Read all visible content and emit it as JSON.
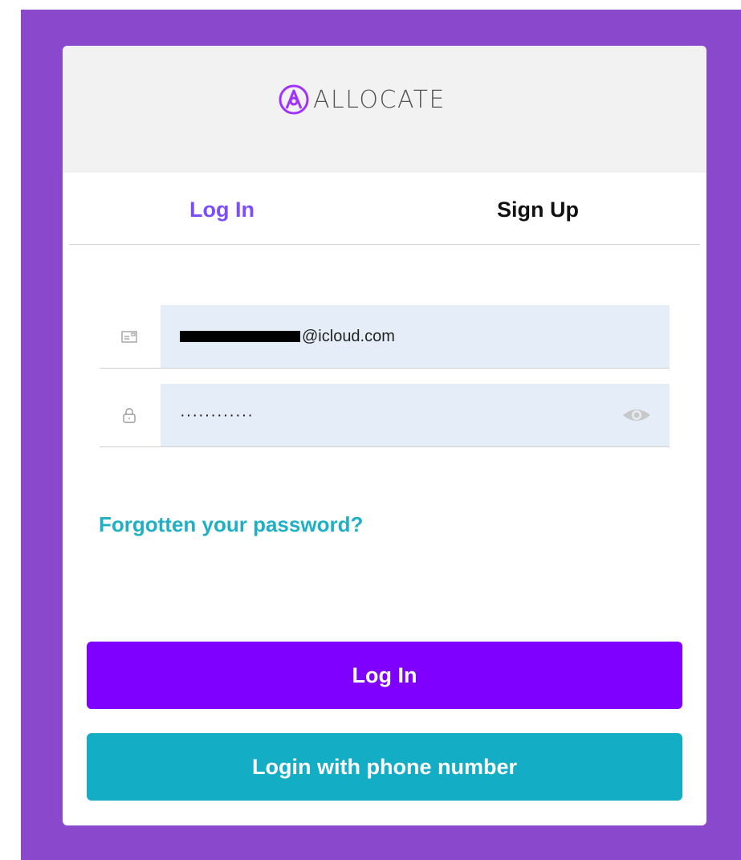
{
  "brand": {
    "name": "ALLOCATE",
    "accent": "#a033ff"
  },
  "tabs": [
    {
      "label": "Log In",
      "active": true
    },
    {
      "label": "Sign Up",
      "active": false
    }
  ],
  "form": {
    "email": {
      "icon": "envelope-card-icon",
      "value_suffix": "@icloud.com",
      "redacted_prefix": true
    },
    "password": {
      "icon": "lock-icon",
      "masked_value": "············",
      "toggle_icon": "eye-icon"
    }
  },
  "links": {
    "forgot_password": "Forgotten your password?"
  },
  "buttons": {
    "login": "Log In",
    "phone_login": "Login with phone number"
  },
  "colors": {
    "background": "#8a48cc",
    "tab_active": "#7b4dff",
    "link": "#1fb0c6",
    "login_button": "#8000ff",
    "phone_button": "#13adc6",
    "input_bg": "#e5eef8"
  }
}
